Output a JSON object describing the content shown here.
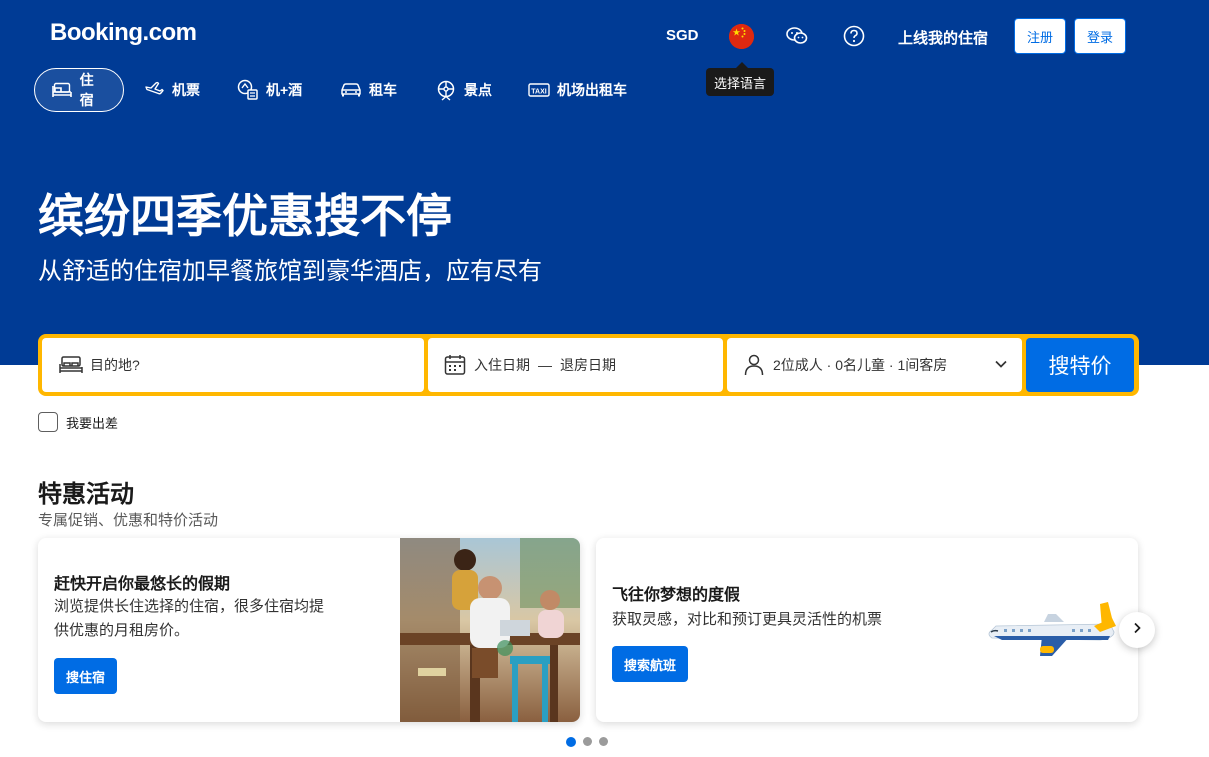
{
  "header": {
    "logo": "Booking.com",
    "currency": "SGD",
    "language_flag": "china-flag",
    "tooltip": "选择语言",
    "list_property": "上线我的住宿",
    "register": "注册",
    "login": "登录",
    "icons": [
      "wechat-icon",
      "help-icon"
    ]
  },
  "nav": {
    "items": [
      {
        "label": "住宿",
        "icon": "bed-icon",
        "active": true
      },
      {
        "label": "机票",
        "icon": "plane-icon",
        "active": false
      },
      {
        "label": "机+酒",
        "icon": "flight-hotel-icon",
        "active": false
      },
      {
        "label": "租车",
        "icon": "car-icon",
        "active": false
      },
      {
        "label": "景点",
        "icon": "attractions-icon",
        "active": false
      },
      {
        "label": "机场出租车",
        "icon": "taxi-icon",
        "active": false
      }
    ]
  },
  "hero": {
    "title": "缤纷四季优惠搜不停",
    "subtitle": "从舒适的住宿加早餐旅馆到豪华酒店，应有尽有"
  },
  "search": {
    "destination_placeholder": "目的地?",
    "checkin": "入住日期",
    "date_separator": "—",
    "checkout": "退房日期",
    "guests": "2位成人 · 0名儿童 · 1间客房",
    "button": "搜特价",
    "business_travel": "我要出差"
  },
  "deals": {
    "title": "特惠活动",
    "subtitle": "专属促销、优惠和特价活动",
    "cards": [
      {
        "title": "赶快开启你最悠长的假期",
        "text_line1": "浏览提供长住选择的住宿，很多住宿均提",
        "text_line2": "供优惠的月租房价。",
        "button": "搜住宿"
      },
      {
        "title": "飞往你梦想的度假",
        "text": "获取灵感，对比和预订更具灵活性的机票",
        "button": "搜索航班"
      }
    ],
    "pagination": {
      "pages": 3,
      "current": 1
    }
  },
  "colors": {
    "brand_blue": "#003b95",
    "action_blue": "#006ce4",
    "search_border": "#ffb700"
  }
}
